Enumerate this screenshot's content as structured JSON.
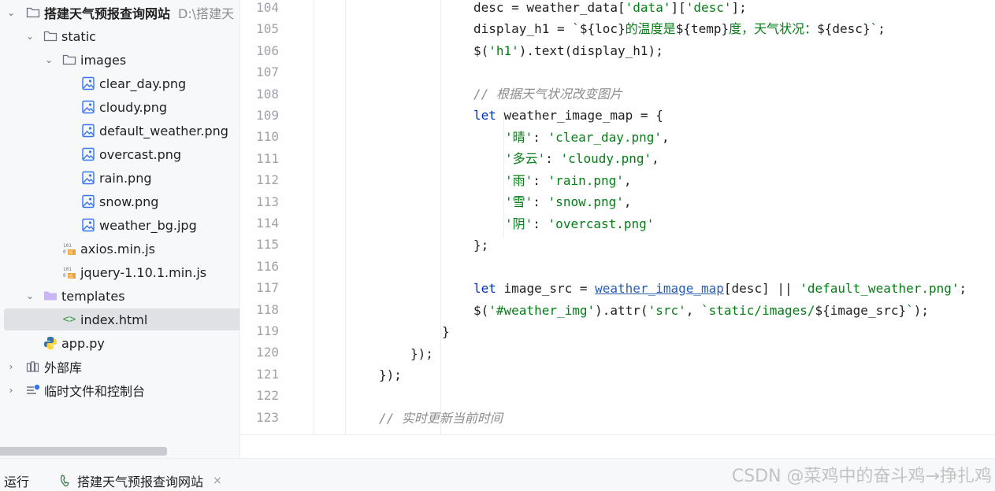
{
  "tree": {
    "project": {
      "name": "搭建天气预报查询网站",
      "path": "D:\\搭建天"
    },
    "static": "static",
    "images": "images",
    "image_files": [
      "clear_day.png",
      "cloudy.png",
      "default_weather.png",
      "overcast.png",
      "rain.png",
      "snow.png",
      "weather_bg.jpg"
    ],
    "js_files": [
      "axios.min.js",
      "jquery-1.10.1.min.js"
    ],
    "templates": "templates",
    "index": "index.html",
    "app": "app.py",
    "external_libs": "外部库",
    "scratches": "临时文件和控制台"
  },
  "editor": {
    "line_numbers": [
      "104",
      "105",
      "106",
      "107",
      "108",
      "109",
      "110",
      "111",
      "112",
      "113",
      "114",
      "115",
      "116",
      "117",
      "118",
      "119",
      "120",
      "121",
      "122",
      "123"
    ],
    "l104": {
      "a": "desc = weather_data[",
      "s1": "'data'",
      "b": "][",
      "s2": "'desc'",
      "c": "];"
    },
    "l105": {
      "a": "display_h1 = ",
      "s1": "`",
      "b": "${loc}",
      "s2": "的温度是",
      "c": "${temp}",
      "s3": "度，天气状况：",
      "d": "${desc}",
      "s4": "`",
      "e": ";"
    },
    "l106": {
      "a": "$(",
      "s1": "'h1'",
      "b": ").text(display_h1);"
    },
    "l108": {
      "cmt": "// 根据天气状况改变图片"
    },
    "l109": {
      "kw": "let",
      "a": " weather_image_map = {"
    },
    "l110": {
      "k": "'晴'",
      "a": ": ",
      "v": "'clear_day.png'",
      "b": ","
    },
    "l111": {
      "k": "'多云'",
      "a": ": ",
      "v": "'cloudy.png'",
      "b": ","
    },
    "l112": {
      "k": "'雨'",
      "a": ": ",
      "v": "'rain.png'",
      "b": ","
    },
    "l113": {
      "k": "'雪'",
      "a": ": ",
      "v": "'snow.png'",
      "b": ","
    },
    "l114": {
      "k": "'阴'",
      "a": ": ",
      "v": "'overcast.png'"
    },
    "l115": {
      "a": "};"
    },
    "l117": {
      "kw": "let",
      "a": " image_src = ",
      "link": "weather_image_map",
      "b": "[desc] || ",
      "s1": "'default_weather.png'",
      "c": ";"
    },
    "l118": {
      "a": "$(",
      "s1": "'#weather_img'",
      "b": ").attr(",
      "s2": "'src'",
      "c": ", ",
      "s3": "`static/images/",
      "d": "${image_src}",
      "s4": "`",
      "e": ");"
    },
    "l119": {
      "a": "}"
    },
    "l120": {
      "a": "});"
    },
    "l121": {
      "a": "});"
    },
    "l123": {
      "cmt": "// 实时更新当前时间"
    }
  },
  "runbar": {
    "label": "运行",
    "tab": "搭建天气预报查询网站",
    "close": "×"
  },
  "watermark": "CSDN @菜鸡中的奋斗鸡→挣扎鸡",
  "colors": {
    "keyword": "#0033b3",
    "string": "#067d17",
    "comment": "#8c8c8c",
    "link": "#2a5db0"
  }
}
